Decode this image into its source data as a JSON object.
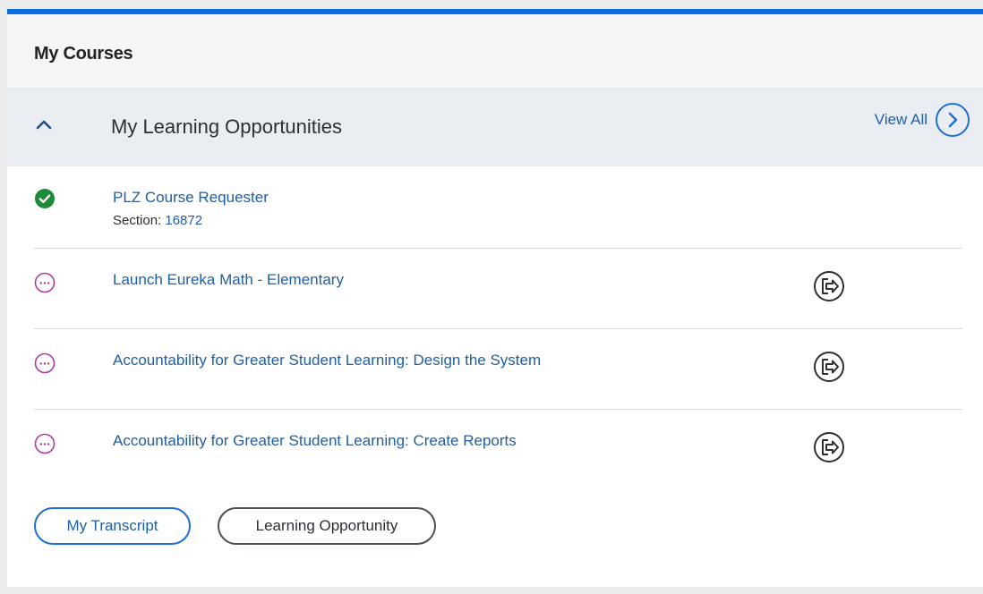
{
  "header": {
    "title": "My Courses"
  },
  "section": {
    "title": "My Learning Opportunities",
    "view_all_label": "View All",
    "toggle_icon": "chevron-up-icon",
    "view_all_icon": "chevron-right-circle-icon"
  },
  "courses": [
    {
      "title": "PLZ Course Requester",
      "section_label": "Section:",
      "section_number": "16872",
      "status": "completed",
      "status_icon": "check-circle-icon"
    },
    {
      "title": "Launch Eureka Math - Elementary",
      "status": "in-progress",
      "status_icon": "ellipsis-circle-icon",
      "action_icon": "launch-icon"
    },
    {
      "title": "Accountability for Greater Student Learning: Design the System",
      "status": "in-progress",
      "status_icon": "ellipsis-circle-icon",
      "action_icon": "launch-icon"
    },
    {
      "title": "Accountability for Greater Student Learning: Create Reports",
      "status": "in-progress",
      "status_icon": "ellipsis-circle-icon",
      "action_icon": "launch-icon"
    }
  ],
  "buttons": {
    "transcript_label": "My Transcript",
    "learning_opportunity_label": "Learning Opportunity"
  },
  "colors": {
    "accent": "#0a6fe0",
    "link": "#1f5fa6",
    "success": "#1e8a3a",
    "pending": "#b03a9e"
  }
}
